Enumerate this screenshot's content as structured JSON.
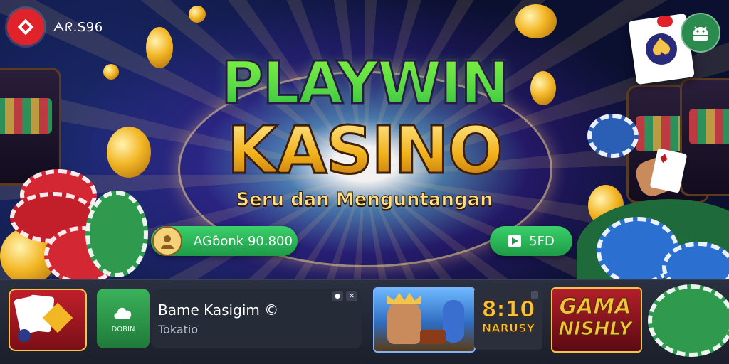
{
  "header": {
    "brand_code": "ᗅᖇ.S96",
    "notification_badge": "",
    "logo_icon": "diamond-card-icon",
    "android_icon": "android-icon"
  },
  "hero": {
    "title_line1": "PLAYWIN",
    "title_line2": "KASINO",
    "subtitle": "Seru dan Menguntangan",
    "balance_button": "AGɓonk 90.800",
    "play_button": "5FD"
  },
  "bottom_bar": {
    "app_title": "Bame Kasigim ©",
    "app_subtitle": "Tokatio",
    "green_tile_label": "DOBIN",
    "time_text": "8:10",
    "time_subtext": "NARUSY",
    "game_title_line1": "GAMA",
    "game_title_line2": "NISHLY",
    "window_controls": [
      "●",
      "✕"
    ]
  },
  "colors": {
    "accent_red": "#e0222a",
    "accent_green": "#2fbf5b",
    "gold": "#f3c34a",
    "background": "#0b1030"
  }
}
